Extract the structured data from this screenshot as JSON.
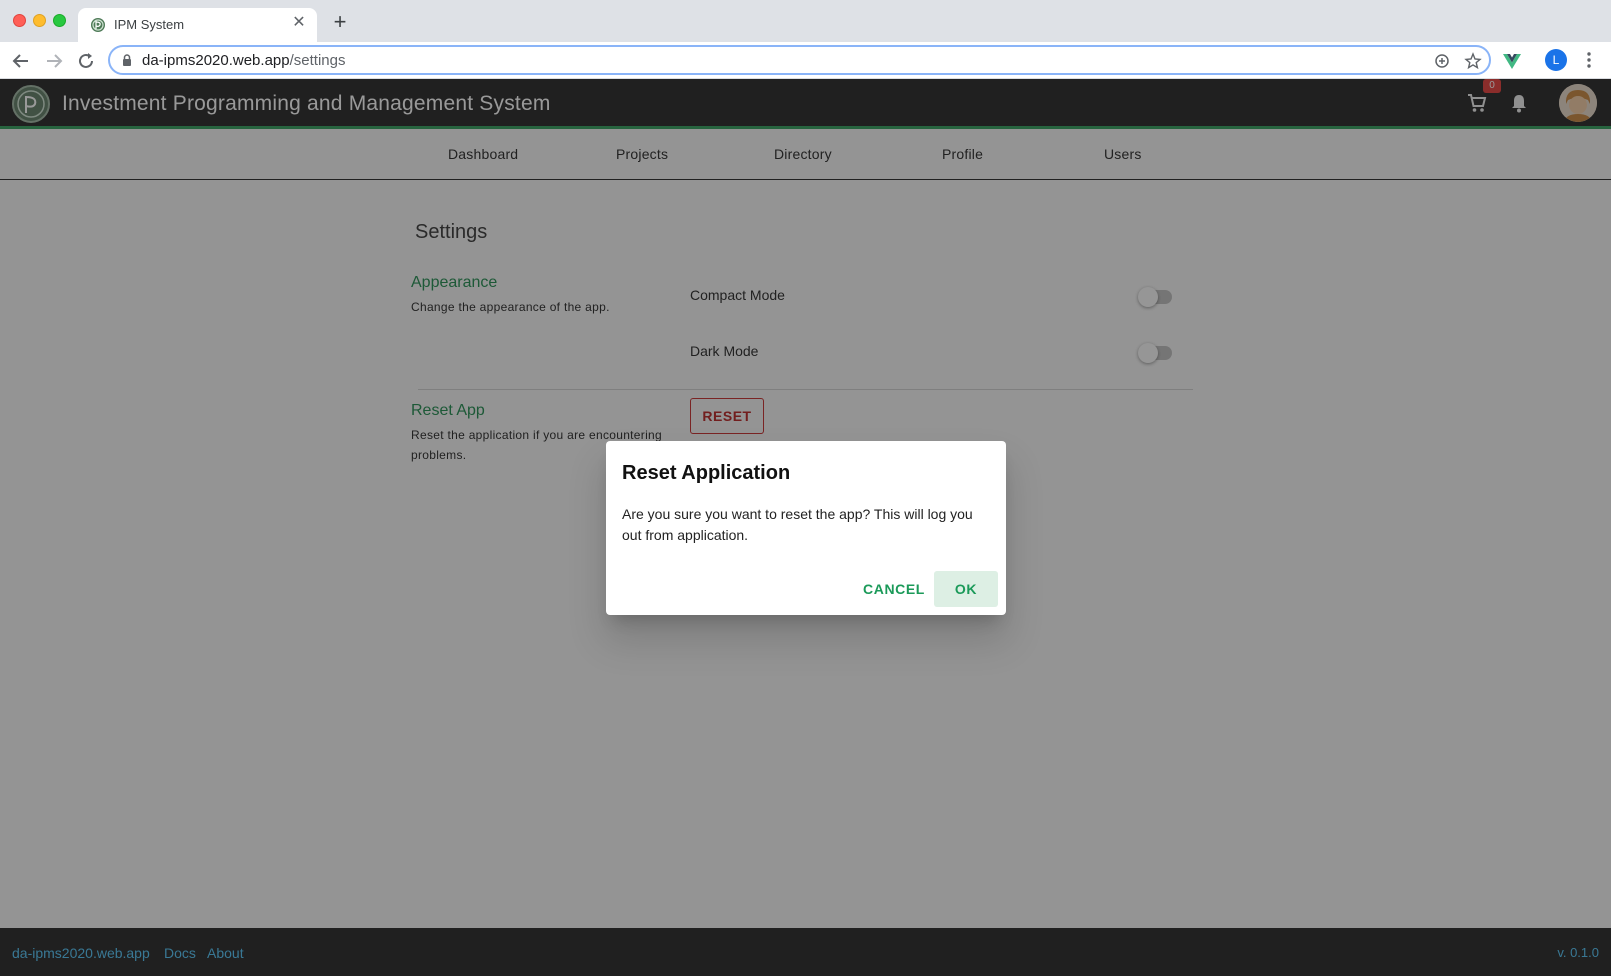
{
  "browser": {
    "tab_title": "IPM System",
    "url_host": "da-ipms2020.web.app",
    "url_path": "/settings",
    "profile_initial": "L"
  },
  "app": {
    "title": "Investment Programming and Management System",
    "cart_count": "0",
    "nav": [
      "Dashboard",
      "Projects",
      "Directory",
      "Profile",
      "Users"
    ]
  },
  "settings": {
    "page_title": "Settings",
    "appearance": {
      "title": "Appearance",
      "description": "Change the appearance of the app.",
      "compact_mode_label": "Compact Mode",
      "compact_mode_on": false,
      "dark_mode_label": "Dark Mode",
      "dark_mode_on": false
    },
    "reset": {
      "title": "Reset App",
      "description_line1": "Reset the application if you are encountering",
      "description_line2": "problems.",
      "button_label": "RESET"
    }
  },
  "dialog": {
    "title": "Reset Application",
    "text_line1": "Are you sure you want to reset the app? This will log you",
    "text_line2": "out from application.",
    "cancel_label": "CANCEL",
    "ok_label": "OK"
  },
  "footer": {
    "site_link": "da-ipms2020.web.app",
    "docs_link": "Docs",
    "about_link": "About",
    "version": "v. 0.1.0"
  },
  "colors": {
    "accent_green": "#1b9a59",
    "danger_red": "#c62828",
    "header_bg": "#212121",
    "footer_link": "#4fc3f7"
  }
}
